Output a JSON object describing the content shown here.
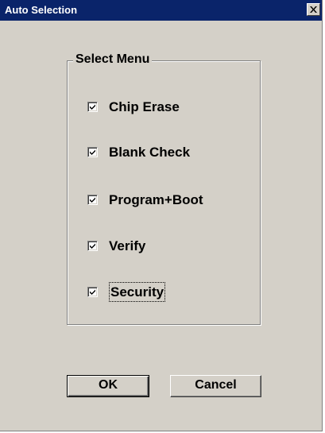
{
  "window": {
    "title": "Auto Selection",
    "close_glyph": "×"
  },
  "group": {
    "title": "Select Menu"
  },
  "options": [
    {
      "label": "Chip Erase",
      "checked": true
    },
    {
      "label": "Blank Check",
      "checked": true
    },
    {
      "label": "Program+Boot",
      "checked": true
    },
    {
      "label": "Verify",
      "checked": true
    },
    {
      "label": "Security",
      "checked": true,
      "focused": true
    }
  ],
  "buttons": {
    "ok_label": "OK",
    "cancel_label": "Cancel"
  },
  "colors": {
    "titlebar": "#0a246a",
    "face": "#d4d0c8"
  },
  "icons": {
    "close": "close-icon",
    "check": "checkmark-icon"
  }
}
